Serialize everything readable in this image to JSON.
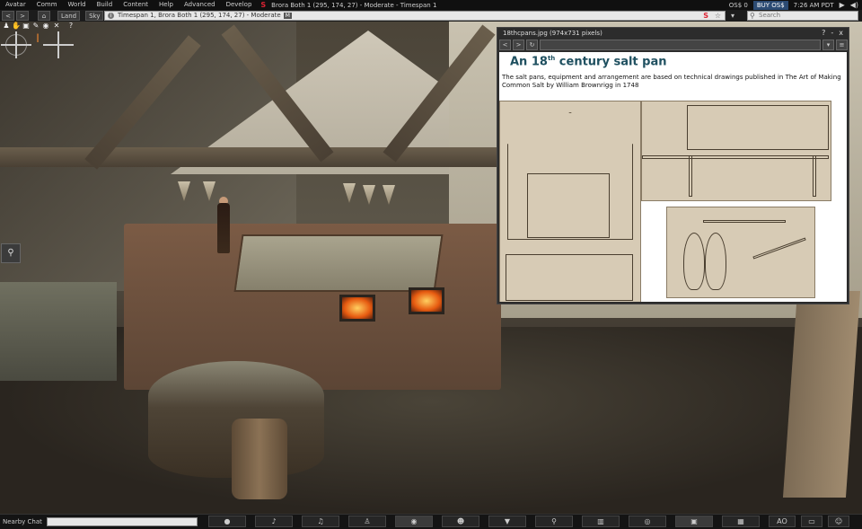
{
  "menubar": {
    "items": [
      "Avatar",
      "Comm",
      "World",
      "Build",
      "Content",
      "Help",
      "Advanced",
      "Develop"
    ],
    "title": "Brora Both 1 (295, 174, 27) - Moderate - Timespan 1",
    "balance": "OS$ 0",
    "buy_label": "BUY OS$",
    "clock": "7:26 AM PDT"
  },
  "navbar": {
    "back": "<",
    "forward": ">",
    "home_icon": "home-icon",
    "land": "Land",
    "sky": "Sky",
    "location": "Timespan 1, Brora Both 1 (295, 174, 27) - Moderate",
    "rating_badge": "M",
    "search_placeholder": "Search"
  },
  "popup": {
    "title": "18thcpans.jpg (974x731 pixels)",
    "help": "?",
    "minimize": "-",
    "close": "x",
    "url": "",
    "heading_main": "An 18",
    "heading_sup": "th",
    "heading_tail": " century salt pan",
    "description": "The salt pans, equipment and arrangement are based on technical drawings published  in The Art of Making Common Salt by William Brownrigg in 1748"
  },
  "bottombar": {
    "nearby_chat": "Nearby Chat",
    "ao_label": "AO",
    "tools": [
      "speech-icon",
      "microphone-icon",
      "headphones-icon",
      "walk-icon",
      "eye-icon",
      "people-icon",
      "shirt-icon",
      "search-icon",
      "map-icon",
      "minimap-icon",
      "camera-icon",
      "inventory-icon",
      "AO",
      "settings-icon",
      "gesture-icon"
    ]
  }
}
